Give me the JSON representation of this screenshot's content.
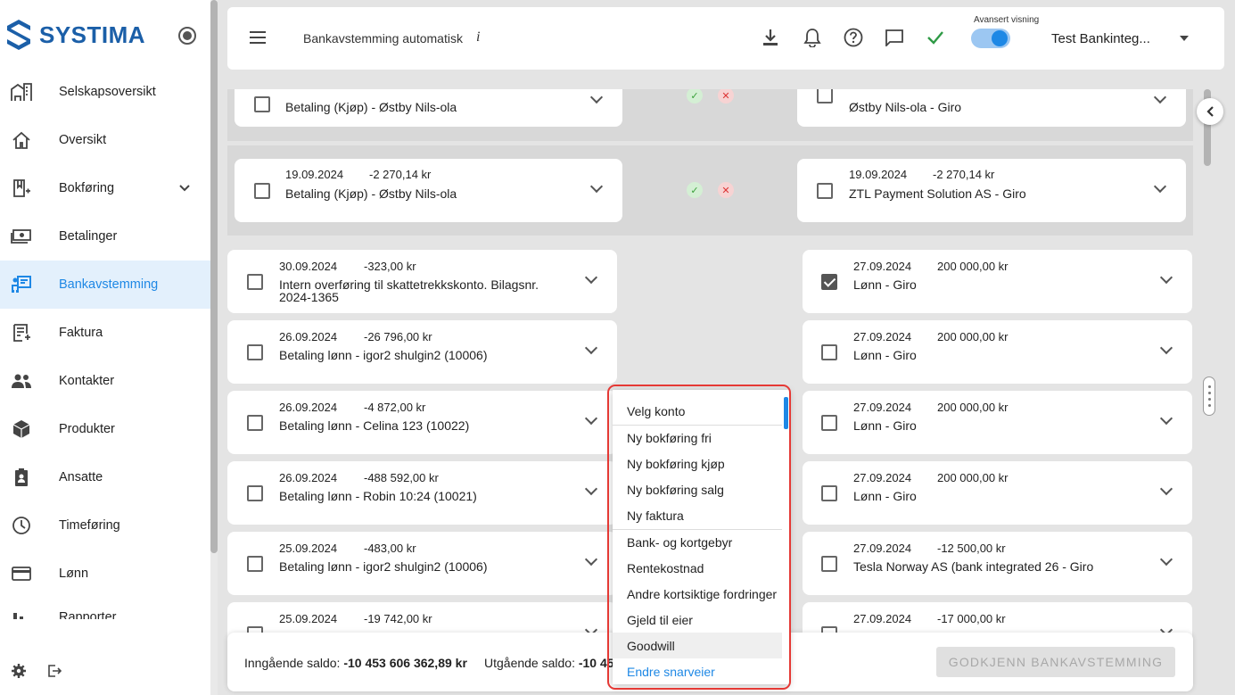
{
  "sidebar": {
    "logo": "SYSTIMA",
    "items": [
      {
        "label": "Selskapsoversikt",
        "icon": "company-overview-icon"
      },
      {
        "label": "Oversikt",
        "icon": "home-icon"
      },
      {
        "label": "Bokføring",
        "icon": "bookkeeping-icon"
      },
      {
        "label": "Betalinger",
        "icon": "payments-icon"
      },
      {
        "label": "Bankavstemming",
        "icon": "bank-reconciliation-icon"
      },
      {
        "label": "Faktura",
        "icon": "invoice-icon"
      },
      {
        "label": "Kontakter",
        "icon": "contacts-icon"
      },
      {
        "label": "Produkter",
        "icon": "products-icon"
      },
      {
        "label": "Ansatte",
        "icon": "employees-icon"
      },
      {
        "label": "Timeføring",
        "icon": "clock-icon"
      },
      {
        "label": "Lønn",
        "icon": "salary-card-icon"
      },
      {
        "label": "Rapporter",
        "icon": "reports-icon"
      }
    ],
    "active": "Bankavstemming"
  },
  "topbar": {
    "title": "Bankavstemming automatisk",
    "info": "i",
    "advanced_label": "Avansert visning",
    "company": "Test Bankinteg...",
    "accent": "#1e88e5"
  },
  "matched_groups": [
    {
      "left": {
        "date": "",
        "amount": "",
        "desc": "Betaling (Kjøp) - Østby Nils-ola"
      },
      "right": {
        "date": "",
        "amount": "",
        "desc": "Østby Nils-ola - Giro"
      }
    },
    {
      "left": {
        "date": "19.09.2024",
        "amount": "-2 270,14 kr",
        "desc": "Betaling (Kjøp) - Østby Nils-ola"
      },
      "right": {
        "date": "19.09.2024",
        "amount": "-2 270,14 kr",
        "desc": "ZTL Payment Solution AS - Giro"
      }
    }
  ],
  "left_rows": [
    {
      "date": "30.09.2024",
      "amount": "-323,00 kr",
      "desc": "Intern overføring til skattetrekkskonto. Bilagsnr. 2024-1365"
    },
    {
      "date": "26.09.2024",
      "amount": "-26 796,00 kr",
      "desc": "Betaling lønn - igor2 shulgin2 (10006)"
    },
    {
      "date": "26.09.2024",
      "amount": "-4 872,00 kr",
      "desc": "Betaling lønn - Celina 123 (10022)"
    },
    {
      "date": "26.09.2024",
      "amount": "-488 592,00 kr",
      "desc": "Betaling lønn - Robin 10:24 (10021)"
    },
    {
      "date": "25.09.2024",
      "amount": "-483,00 kr",
      "desc": "Betaling lønn - igor2 shulgin2 (10006)"
    },
    {
      "date": "25.09.2024",
      "amount": "-19 742,00 kr",
      "desc": ""
    }
  ],
  "right_rows": [
    {
      "date": "27.09.2024",
      "amount": "200 000,00 kr",
      "desc": "Lønn - Giro",
      "checked": true
    },
    {
      "date": "27.09.2024",
      "amount": "200 000,00 kr",
      "desc": "Lønn - Giro",
      "checked": false
    },
    {
      "date": "27.09.2024",
      "amount": "200 000,00 kr",
      "desc": "Lønn - Giro",
      "checked": false
    },
    {
      "date": "27.09.2024",
      "amount": "200 000,00 kr",
      "desc": "Lønn - Giro",
      "checked": false
    },
    {
      "date": "27.09.2024",
      "amount": "-12 500,00 kr",
      "desc": "Tesla Norway AS (bank integrated 26 - Giro",
      "checked": false
    },
    {
      "date": "27.09.2024",
      "amount": "-17 000,00 kr",
      "desc": "",
      "checked": false
    }
  ],
  "dropdown": {
    "header": "Velg konto",
    "group1": [
      "Ny bokføring fri",
      "Ny bokføring kjøp",
      "Ny bokføring salg",
      "Ny faktura"
    ],
    "group2": [
      "Bank- og kortgebyr",
      "Rentekostnad",
      "Andre kortsiktige fordringer",
      "Gjeld til eier",
      "Goodwill"
    ],
    "link": "Endre snarveier"
  },
  "bottombar": {
    "opening_label": "Inngående saldo:",
    "opening_value": "-10 453 606 362,89 kr",
    "closing_label": "Utgående saldo:",
    "closing_value": "-10 45",
    "approve_button": "GODKJENN BANKAVSTEMMING"
  }
}
